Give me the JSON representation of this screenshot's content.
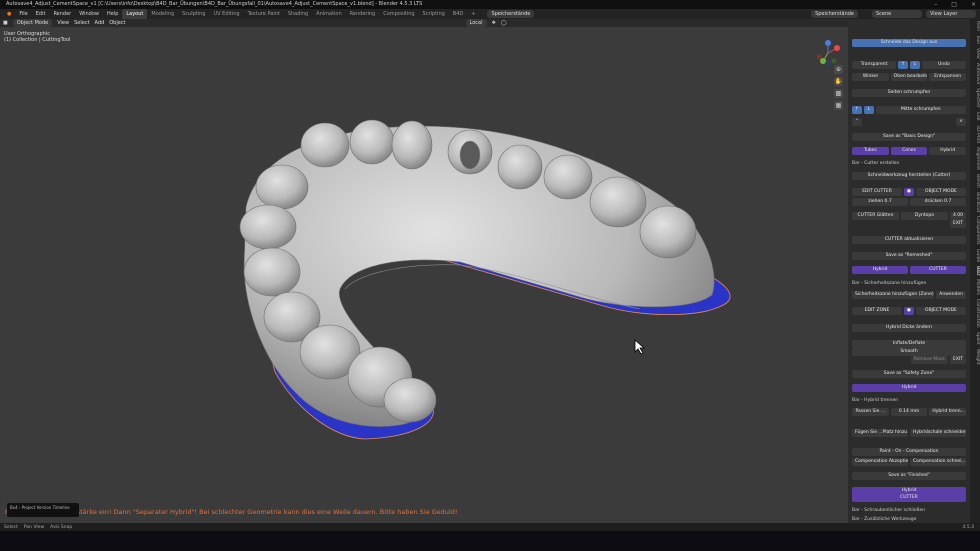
{
  "title_bar": {
    "text": "Autosave4_Adjust_CementSpace_v1 [C:\\Users\\info\\Desktop\\B4D_Bar_Übungen\\B4D_Bar_Übungsfall_01\\Autosave4_Adjust_CementSpace_v1.blend] - Blender 4.5.3 LTS"
  },
  "menu": {
    "items": [
      "File",
      "Edit",
      "Render",
      "Window",
      "Help"
    ]
  },
  "workspaces": [
    "Layout",
    "Modeling",
    "Sculpting",
    "UV Editing",
    "Texture Paint",
    "Shading",
    "Animation",
    "Rendering",
    "Compositing",
    "Scripting",
    "B4D"
  ],
  "topbar_right": {
    "save_label_left": "Speicherstände",
    "save_label_right": "Speicherstände",
    "scene": "Scene",
    "view_layer": "View Layer"
  },
  "toolbar": {
    "mode": "Object Mode",
    "items": [
      "View",
      "Select",
      "Add",
      "Object"
    ],
    "orientation": "Local"
  },
  "viewport": {
    "view_name": "User Orthographic",
    "collection_line": "(1) Collection | CuttingTool",
    "status_message": "Bitte Dicke der Hybridstärke ein! Dann \"Separater Hybrid\"! Bei schlechter Geometrie kann dies eine Weile dauern. Bitte haben Sie Geduld!",
    "thumbnail_label": "Bx4 - Project Version Timeline"
  },
  "statusbar": {
    "items": [
      "Select",
      "Pan View",
      "Axis Snap"
    ],
    "version": "4.5.3"
  },
  "panel": {
    "design_cut": "Schneide das Design aus",
    "transparent": "Transparent",
    "undo": "Undo",
    "angle": "Winkel",
    "top_edit": "Oben bearbeiten",
    "relax": "Entspannen",
    "shrink_sides": "Seiten schrumpfen",
    "shrink_middle": "Mitte schrumpfen",
    "save_basic": "Save as \"Basic Design\"",
    "tabs": [
      "Tubes",
      "Cones",
      "Hybrid"
    ],
    "cutter_section": "Bar - Cutter erstellen",
    "cutter_create": "Schneidwerkzeug herstellen (Cutter)",
    "edit_cutter": "EDIT CUTTER",
    "object_mode": "OBJECT MODE",
    "pull": "ziehen 0.7",
    "press": "drücken 0.7",
    "cutter_smooth": "CUTTER Glätten",
    "dyntopo": "Dyntopo",
    "dyntopo_value": "4.00",
    "exit": "EXIT",
    "cutter_update": "CUTTER aktualisieren",
    "save_remeshed": "Save as \"Remeshed\"",
    "hybrid": "Hybrid",
    "cutter": "CUTTER",
    "safety_section": "Bar - Sicherheitszone hinzufügen",
    "safety_add": "Sicherheitszone hinzufügen (Zone)",
    "apply": "Anwenden",
    "edit_zone": "EDIT ZONE",
    "object_mode_2": "OBJECT MODE",
    "hybrid_thickness": "Hybrid Dicke ändern",
    "inflate": "Inflate/Deflate",
    "smooth": "Smooth",
    "remove_mask": "Remove Mask",
    "exit2": "EXIT",
    "save_safety": "Save as \"Safety Zone\"",
    "hybrid2": "Hybrid",
    "hybrid_sep_section": "Bar - Hybrid trennen",
    "fit_label": "Passen Sie ...",
    "fit_value": "0.14 mm",
    "hybrid_separate": "Hybrid trenn...",
    "add_space": "Fügen Sie ...Platz hinzu",
    "cut_hybrid": "Hybridschale schneiden",
    "paint_comp": "Paint - On - Compensation",
    "comp_accept": "Compensation Akzeptieren",
    "comp_cut": "Compensation schnei...",
    "save_finished": "Save as \"Finished\"",
    "hybrid3": "Hybrid",
    "cutter3": "CUTTER",
    "screw_section": "Bar - Schraubenlöcher schließen",
    "tools_section": "Bar - Zusätzliche Werkzeuge"
  },
  "side_tabs": [
    "Item",
    "Tool",
    "View",
    "AutoSave",
    "Speicher",
    "Edit",
    "3D-Print",
    "Alignment",
    "Bench",
    "BlockOut",
    "Components",
    "Guide",
    "B4D",
    "Models",
    "Construction",
    "Splint",
    "Weight"
  ],
  "colors": {
    "accent_blue": "#4772b3",
    "accent_purple": "#5b3fa8",
    "model_gray": "#c9c9c9",
    "cement_blue": "#2a35c8",
    "status_orange": "#e0703a"
  }
}
